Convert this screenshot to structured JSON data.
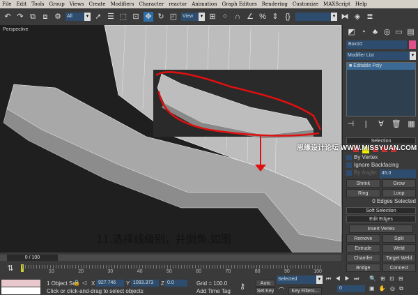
{
  "menu": [
    "File",
    "Edit",
    "Tools",
    "Group",
    "Views",
    "Create",
    "Modifiers",
    "Character",
    "reactor",
    "Animation",
    "Graph Editors",
    "Rendering",
    "Customize",
    "MAXScript",
    "Help"
  ],
  "toolbar": {
    "selection_filter": "All",
    "ref_coord": "View",
    "named_selection": ""
  },
  "viewport": {
    "label": "Perspective",
    "caption": "11.选择线级别，并倒角.如图",
    "watermark": "思缘设计论坛 WWW.MISSYUAN.COM"
  },
  "command_panel": {
    "object_name": "Box10",
    "object_color": "#e0508a",
    "modifier_list": "Modifier List",
    "stack": [
      "Editable Poly"
    ],
    "selection": {
      "title": "Selection",
      "by_vertex": "By Vertex",
      "ignore_backfacing": "Ignore Backfacing",
      "by_angle": "By Angle:",
      "angle": "45.0",
      "shrink": "Shrink",
      "grow": "Grow",
      "ring": "Ring",
      "loop": "Loop",
      "status": "0 Edges Selected"
    },
    "soft_selection": "Soft Selection",
    "edit_edges": {
      "title": "Edit Edges",
      "insert_vertex": "Insert Vertex",
      "remove": "Remove",
      "split": "Split",
      "extrude": "Extrude",
      "weld": "Weld",
      "chamfer": "Chamfer",
      "target_weld": "Target Weld",
      "bridge": "Bridge",
      "connect": "Connect"
    }
  },
  "timeline": {
    "frame": "0 / 100",
    "ticks": [
      "10",
      "20",
      "30",
      "40",
      "50",
      "60",
      "70",
      "80",
      "90",
      "100"
    ]
  },
  "status": {
    "selection": "1 Object Se",
    "prompt": "Click or click-and-drag to select objects",
    "x": "927.746",
    "y": "1093.373",
    "z": "0.0",
    "grid": "Grid = 100.0",
    "add_time_tag": "Add Time Tag",
    "auto_key": "Auto Key",
    "set_key": "Set Key",
    "key_mode": "Selected",
    "key_filters": "Key Filters...",
    "current_frame": "0"
  }
}
